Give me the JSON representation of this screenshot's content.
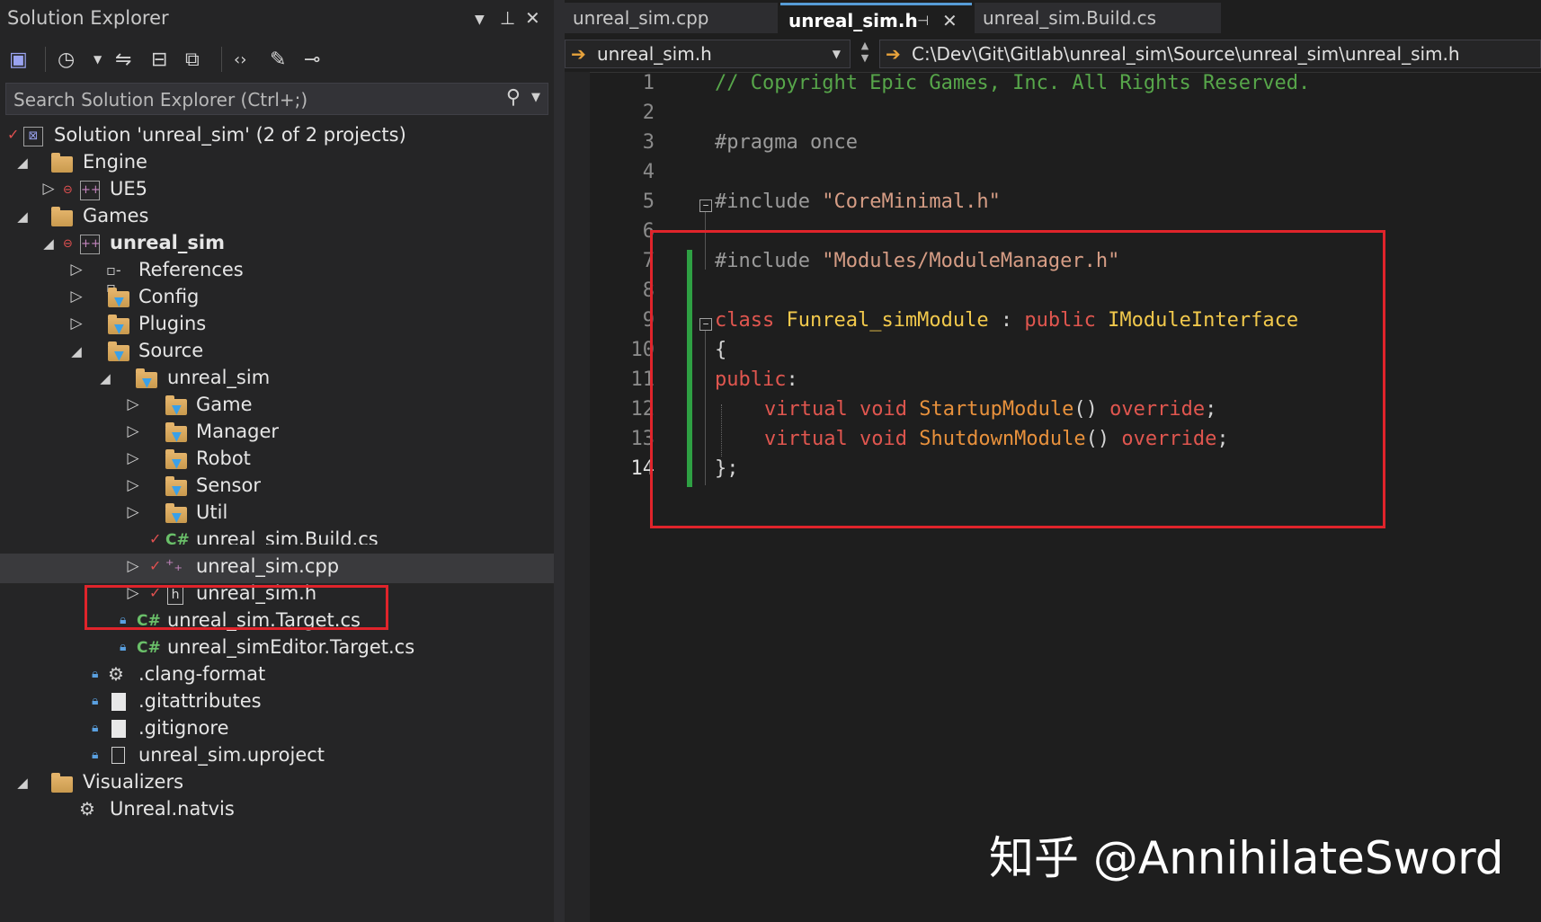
{
  "solution_explorer": {
    "title": "Solution Explorer",
    "search_placeholder": "Search Solution Explorer (Ctrl+;)",
    "tree": [
      {
        "label": "Solution 'unreal_sim' (2 of 2 projects)"
      },
      {
        "label": "Engine"
      },
      {
        "label": "UE5"
      },
      {
        "label": "Games"
      },
      {
        "label": "unreal_sim"
      },
      {
        "label": "References"
      },
      {
        "label": "Config"
      },
      {
        "label": "Plugins"
      },
      {
        "label": "Source"
      },
      {
        "label": "unreal_sim"
      },
      {
        "label": "Game"
      },
      {
        "label": "Manager"
      },
      {
        "label": "Robot"
      },
      {
        "label": "Sensor"
      },
      {
        "label": "Util"
      },
      {
        "label": "unreal_sim.Build.cs"
      },
      {
        "label": "unreal_sim.cpp"
      },
      {
        "label": "unreal_sim.h"
      },
      {
        "label": "unreal_sim.Target.cs"
      },
      {
        "label": "unreal_simEditor.Target.cs"
      },
      {
        "label": ".clang-format"
      },
      {
        "label": ".gitattributes"
      },
      {
        "label": ".gitignore"
      },
      {
        "label": "unreal_sim.uproject"
      },
      {
        "label": "Visualizers"
      },
      {
        "label": "Unreal.natvis"
      }
    ]
  },
  "editor": {
    "tabs": [
      {
        "label": "unreal_sim.cpp"
      },
      {
        "label": "unreal_sim.h"
      },
      {
        "label": "unreal_sim.Build.cs"
      }
    ],
    "nav_file": "unreal_sim.h",
    "nav_path": "C:\\Dev\\Git\\Gitlab\\unreal_sim\\Source\\unreal_sim\\unreal_sim.h",
    "line_numbers": [
      "1",
      "2",
      "3",
      "4",
      "5",
      "6",
      "7",
      "8",
      "9",
      "10",
      "11",
      "12",
      "13",
      "14"
    ],
    "code": {
      "l1": "// Copyright Epic Games, Inc. All Rights Reserved.",
      "l3": "#pragma once",
      "l5_dir": "#include ",
      "l5_str": "\"CoreMinimal.h\"",
      "l7_dir": "#include ",
      "l7_str": "\"Modules/ModuleManager.h\"",
      "l9_kw1": "class",
      "l9_name": "Funreal_simModule",
      "l9_colon": " : ",
      "l9_kw2": "public",
      "l9_base": "IModuleInterface",
      "l10": "{",
      "l11_kw": "public",
      "l11_colon": ":",
      "l12_kw": "virtual void",
      "l12_fn": "StartupModule",
      "l12_paren": "()",
      "l12_ov": "override",
      "l12_end": ";",
      "l13_kw": "virtual void",
      "l13_fn": "ShutdownModule",
      "l13_paren": "()",
      "l13_ov": "override",
      "l13_end": ";",
      "l14": "};"
    }
  },
  "watermark": "知乎 @AnnihilateSword",
  "colors": {
    "highlight_box": "#e0242b",
    "change_bar": "#2ea043",
    "comment": "#57a64a",
    "keyword": "#e0564f",
    "type": "#f2c94c",
    "string": "#d69d85"
  }
}
